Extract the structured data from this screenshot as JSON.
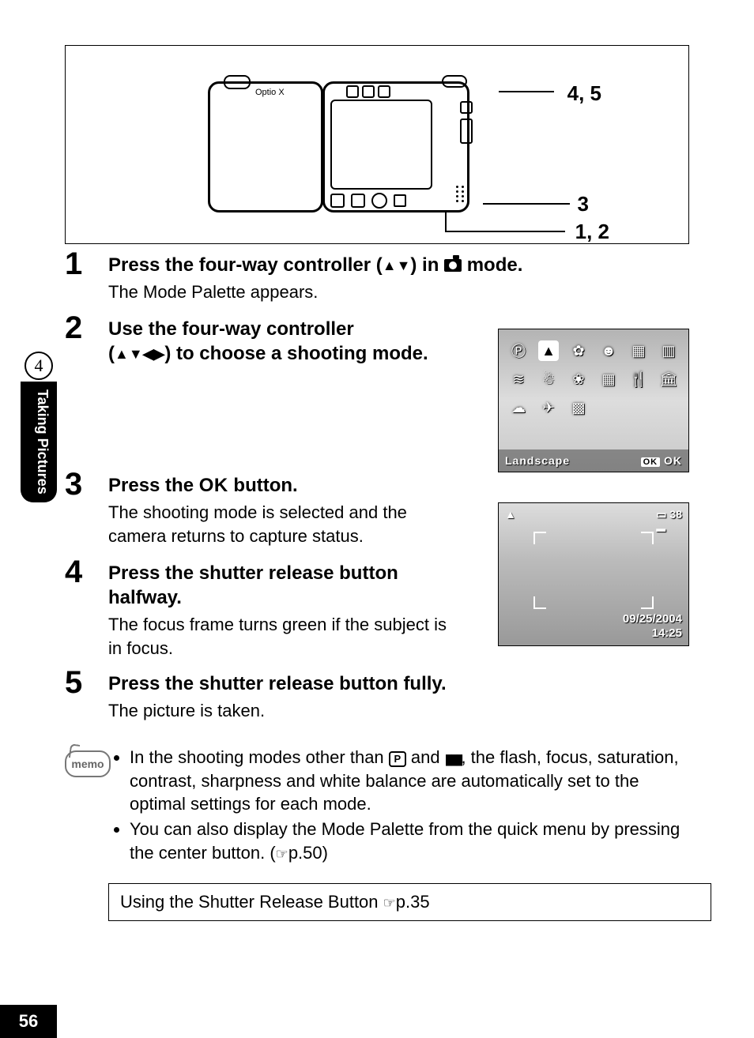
{
  "sidebar": {
    "chapter": "4",
    "title": "Taking Pictures"
  },
  "diagram": {
    "camera_brand": "Optio X",
    "callouts": {
      "top": "4, 5",
      "mid": "3",
      "bottom": "1, 2"
    }
  },
  "steps": [
    {
      "num": "1",
      "heading_pre": "Press the four-way controller (",
      "heading_arrows": "▲▼",
      "heading_post": ") in ",
      "heading_end": " mode.",
      "desc": "The Mode Palette appears."
    },
    {
      "num": "2",
      "heading_l1": "Use the four-way controller ",
      "heading_l2_pre": "(",
      "heading_arrows": "▲▼◀▶",
      "heading_l2_post": ") to choose a shooting mode."
    },
    {
      "num": "3",
      "heading_pre": "Press the ",
      "ok": "OK",
      "heading_post": " button.",
      "desc": "The shooting mode is selected and the camera returns to capture status."
    },
    {
      "num": "4",
      "heading": "Press the shutter release button halfway.",
      "desc": "The focus frame turns green if the subject is in focus."
    },
    {
      "num": "5",
      "heading": "Press the shutter release button fully.",
      "desc": "The picture is taken."
    }
  ],
  "shot1": {
    "label": "Landscape",
    "ok_btn": "OK",
    "ok_text": "OK",
    "icons": [
      "P",
      "▲",
      "✿",
      "☻",
      "▦",
      "▥",
      "≋",
      "☃",
      "❀",
      "▦",
      "🍴",
      "🏛",
      "☁",
      "✈",
      "▩"
    ]
  },
  "shot2": {
    "mode_icon": "▲",
    "count": "38",
    "date": "09/25/2004",
    "time": "14:25"
  },
  "memo": {
    "label": "memo",
    "items": [
      {
        "pre": "In the shooting modes other than ",
        "p": "P",
        "mid": " and ",
        "post": ", the flash, focus, saturation, contrast, sharpness and white balance are automatically set to the optimal settings for each mode."
      },
      {
        "pre": "You can also display the Mode Palette from the quick menu by pressing the center button. (",
        "ref": "p.50",
        "post": ")"
      }
    ]
  },
  "refbox": {
    "text": "Using the Shutter Release Button ",
    "page": "p.35"
  },
  "page_number": "56"
}
